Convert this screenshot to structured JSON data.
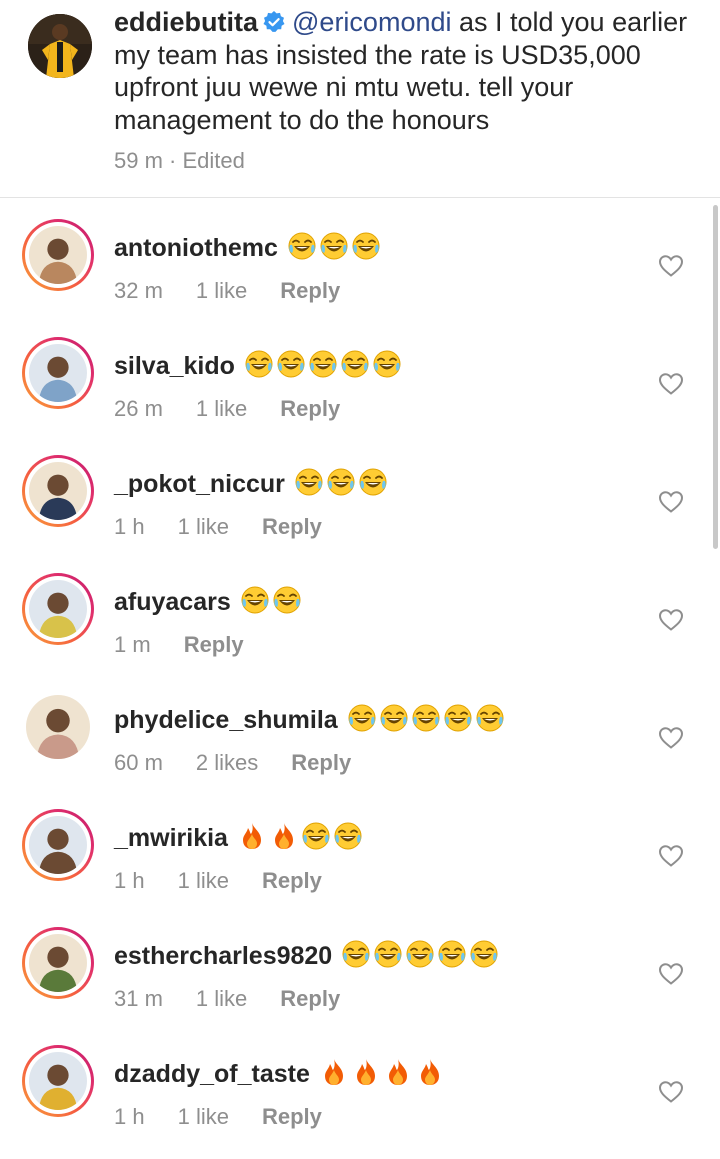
{
  "caption": {
    "username": "eddiebutita",
    "mention": "@ericomondi",
    "text": " as I told you earlier my team has insisted the rate is USD35,000 upfront juu wewe ni mtu wetu. tell your management to do the honours",
    "time": "59 m",
    "separator": "·",
    "edited": "Edited"
  },
  "comments": [
    {
      "username": "antoniothemc",
      "emoji": [
        "joy",
        "joy",
        "joy"
      ],
      "time": "32 m",
      "likes": "1 like",
      "reply": "Reply",
      "story_ring": true,
      "avatar_color": "#b9875f"
    },
    {
      "username": "silva_kido",
      "emoji": [
        "joy",
        "joy",
        "joy",
        "joy",
        "joy"
      ],
      "time": "26 m",
      "likes": "1 like",
      "reply": "Reply",
      "story_ring": true,
      "avatar_color": "#7fa3c8"
    },
    {
      "username": "_pokot_niccur",
      "emoji": [
        "joy",
        "joy",
        "joy"
      ],
      "time": "1 h",
      "likes": "1 like",
      "reply": "Reply",
      "story_ring": true,
      "avatar_color": "#2a3a58"
    },
    {
      "username": "afuyacars",
      "emoji": [
        "joy",
        "joy"
      ],
      "time": "1 m",
      "likes": "",
      "reply": "Reply",
      "story_ring": true,
      "avatar_color": "#d8c24a"
    },
    {
      "username": "phydelice_shumila",
      "emoji": [
        "joy",
        "joy",
        "joy",
        "joy",
        "joy"
      ],
      "time": "60 m",
      "likes": "2 likes",
      "reply": "Reply",
      "story_ring": false,
      "avatar_color": "#c99a8a"
    },
    {
      "username": "_mwirikia",
      "emoji": [
        "fire",
        "fire",
        "joy",
        "joy"
      ],
      "time": "1 h",
      "likes": "1 like",
      "reply": "Reply",
      "story_ring": true,
      "avatar_color": "#6b4a33"
    },
    {
      "username": "esthercharles9820",
      "emoji": [
        "joy",
        "joy",
        "joy",
        "joy",
        "joy"
      ],
      "time": "31 m",
      "likes": "1 like",
      "reply": "Reply",
      "story_ring": true,
      "avatar_color": "#5a7a3a"
    },
    {
      "username": "dzaddy_of_taste",
      "emoji": [
        "fire",
        "fire",
        "fire",
        "fire"
      ],
      "time": "1 h",
      "likes": "1 like",
      "reply": "Reply",
      "story_ring": true,
      "avatar_color": "#e0b030"
    }
  ],
  "colors": {
    "meta": "#8e8e8e",
    "mention": "#2f4a8a",
    "verified": "#3897f0"
  }
}
